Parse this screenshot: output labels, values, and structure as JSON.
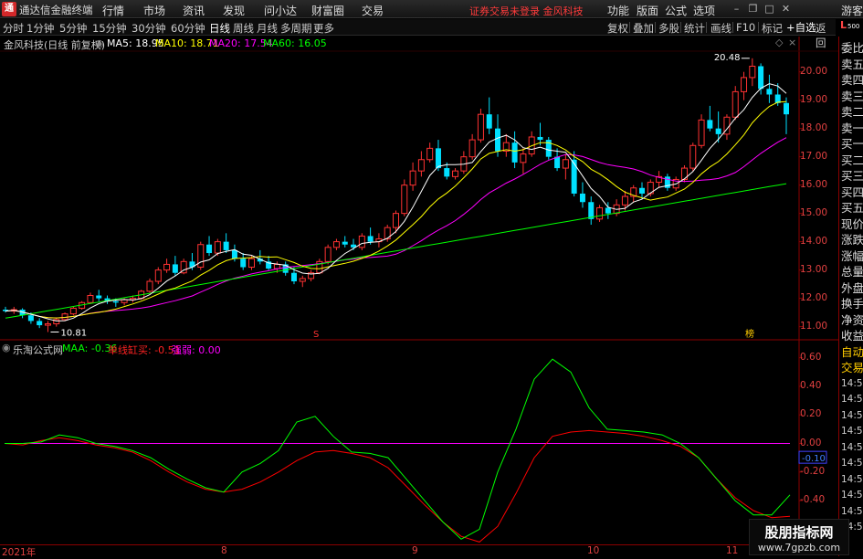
{
  "titlebar": {
    "logo": "通",
    "app_title": "通达信金融终端",
    "menu": [
      "行情",
      "市场",
      "资讯",
      "发现",
      "问小达",
      "财富圈",
      "交易"
    ],
    "warning": "证券交易未登录  金风科技",
    "right_menu": [
      "功能",
      "版面",
      "公式",
      "选项"
    ],
    "guest": "游客"
  },
  "periods": [
    "分时",
    "1分钟",
    "5分钟",
    "15分钟",
    "30分钟",
    "60分钟",
    "日线",
    "周线",
    "月线",
    "多周期",
    "更多"
  ],
  "active_period": "日线",
  "tools": [
    "复权",
    "叠加",
    "多股",
    "统计",
    "画线",
    "F10",
    "标记"
  ],
  "auto_select": "+自选",
  "back": "返回",
  "l_badge": "L",
  "l_sub": "500",
  "main_info": {
    "name": "金风科技(日线 前复权)",
    "ma5": "MA5: 18.95",
    "ma10": "MA10: 18.71",
    "ma20": "MA20: 17.54",
    "ma60": "MA60: 16.05"
  },
  "ind_info": {
    "name": "乐淘公式网",
    "maa": "MAA: -0.36",
    "bs": "单线缸买: -0.51",
    "qr": "强弱: 0.00"
  },
  "price_axis": [
    "20.00",
    "19.00",
    "18.00",
    "17.00",
    "16.00",
    "15.00",
    "14.00",
    "13.00",
    "12.00",
    "11.00"
  ],
  "ind_axis": [
    "0.60",
    "0.40",
    "0.20",
    "0.00",
    "-0.20",
    "-0.40"
  ],
  "ind_current": "-0.10",
  "right_panel": [
    "委比",
    "卖五",
    "卖四",
    "卖三",
    "卖二",
    "卖一",
    "买一",
    "买二",
    "买三",
    "买四",
    "买五",
    "现价",
    "涨跌",
    "涨幅",
    "总量",
    "外盘",
    "换手",
    "净资",
    "收益",
    "自动",
    "交易",
    "14:56",
    "14:56",
    "14:56",
    "14:56",
    "14:56",
    "14:56",
    "14:56",
    "14:56",
    "14:56",
    "14:56"
  ],
  "dates": [
    "2021年",
    "8",
    "9",
    "10",
    "11"
  ],
  "high_label": "20.48",
  "low_label": "10.81",
  "marker_s": "S",
  "marker_b": "榜",
  "watermark": {
    "line1": "股朋指标网",
    "line2": "www.7gpzb.com"
  },
  "colors": {
    "up": "#ff3232",
    "down": "#00e0ff",
    "ma5": "#ffffff",
    "ma10": "#ffff00",
    "ma20": "#ff00ff",
    "ma60": "#00ff00",
    "maa": "#00ff00",
    "bs": "#ff0000",
    "qr": "#ff00ff"
  },
  "chart_data": [
    {
      "type": "candlestick",
      "title": "金风科技(日线 前复权)",
      "ylim": [
        10.6,
        20.7
      ],
      "series_names": [
        "MA5",
        "MA10",
        "MA20",
        "MA60"
      ],
      "ohlc": [
        [
          11.6,
          11.7,
          11.5,
          11.55
        ],
        [
          11.55,
          11.7,
          11.45,
          11.6
        ],
        [
          11.6,
          11.65,
          11.3,
          11.4
        ],
        [
          11.4,
          11.5,
          11.1,
          11.2
        ],
        [
          11.2,
          11.3,
          10.95,
          11.05
        ],
        [
          11.05,
          11.2,
          10.81,
          11.1
        ],
        [
          11.1,
          11.3,
          11.0,
          11.25
        ],
        [
          11.25,
          11.5,
          11.2,
          11.45
        ],
        [
          11.45,
          11.7,
          11.4,
          11.65
        ],
        [
          11.65,
          11.9,
          11.6,
          11.85
        ],
        [
          11.85,
          12.2,
          11.8,
          12.1
        ],
        [
          12.1,
          12.3,
          11.9,
          12.0
        ],
        [
          12.0,
          12.1,
          11.8,
          11.9
        ],
        [
          11.9,
          12.0,
          11.7,
          11.85
        ],
        [
          11.85,
          12.0,
          11.75,
          11.95
        ],
        [
          11.95,
          12.1,
          11.85,
          12.0
        ],
        [
          12.0,
          12.3,
          11.95,
          12.25
        ],
        [
          12.25,
          12.7,
          12.2,
          12.6
        ],
        [
          12.6,
          13.1,
          12.5,
          13.0
        ],
        [
          13.0,
          13.4,
          12.9,
          13.2
        ],
        [
          13.2,
          13.5,
          12.8,
          12.9
        ],
        [
          12.9,
          13.4,
          12.85,
          13.3
        ],
        [
          13.3,
          13.6,
          13.0,
          13.1
        ],
        [
          13.1,
          14.0,
          13.0,
          13.9
        ],
        [
          13.9,
          14.2,
          13.5,
          13.6
        ],
        [
          13.6,
          14.1,
          13.5,
          14.0
        ],
        [
          14.0,
          14.3,
          13.6,
          13.7
        ],
        [
          13.7,
          13.9,
          13.3,
          13.4
        ],
        [
          13.4,
          13.6,
          13.0,
          13.1
        ],
        [
          13.1,
          13.5,
          13.0,
          13.4
        ],
        [
          13.4,
          13.7,
          13.2,
          13.3
        ],
        [
          13.3,
          13.5,
          13.0,
          13.05
        ],
        [
          13.05,
          13.3,
          12.9,
          13.2
        ],
        [
          13.2,
          13.3,
          12.8,
          12.9
        ],
        [
          12.9,
          13.1,
          12.5,
          12.6
        ],
        [
          12.6,
          12.8,
          12.4,
          12.7
        ],
        [
          12.7,
          13.0,
          12.6,
          12.9
        ],
        [
          12.9,
          13.4,
          12.85,
          13.3
        ],
        [
          13.3,
          13.9,
          13.2,
          13.8
        ],
        [
          13.8,
          14.1,
          13.7,
          14.0
        ],
        [
          14.0,
          14.2,
          13.8,
          13.9
        ],
        [
          13.9,
          14.1,
          13.7,
          13.8
        ],
        [
          13.8,
          14.3,
          13.7,
          14.2
        ],
        [
          14.2,
          14.5,
          13.9,
          14.0
        ],
        [
          14.0,
          14.3,
          13.8,
          14.1
        ],
        [
          14.1,
          14.6,
          14.0,
          14.5
        ],
        [
          14.5,
          15.1,
          14.3,
          15.0
        ],
        [
          15.0,
          16.2,
          14.9,
          16.0
        ],
        [
          16.0,
          16.8,
          15.8,
          16.5
        ],
        [
          16.5,
          17.2,
          16.3,
          16.9
        ],
        [
          16.9,
          17.5,
          16.8,
          17.3
        ],
        [
          17.3,
          17.6,
          16.5,
          16.6
        ],
        [
          16.6,
          16.8,
          16.2,
          16.3
        ],
        [
          16.3,
          16.6,
          16.2,
          16.5
        ],
        [
          16.5,
          17.2,
          16.4,
          17.0
        ],
        [
          17.0,
          17.8,
          16.9,
          17.6
        ],
        [
          17.6,
          18.7,
          17.5,
          18.5
        ],
        [
          18.5,
          19.1,
          17.8,
          18.0
        ],
        [
          18.0,
          18.5,
          17.0,
          17.2
        ],
        [
          17.2,
          17.8,
          17.0,
          17.5
        ],
        [
          17.5,
          17.9,
          16.6,
          16.8
        ],
        [
          16.8,
          17.3,
          16.4,
          17.1
        ],
        [
          17.1,
          17.9,
          17.0,
          17.7
        ],
        [
          17.7,
          18.2,
          17.4,
          17.6
        ],
        [
          17.6,
          17.7,
          16.9,
          17.0
        ],
        [
          17.0,
          17.3,
          16.5,
          16.6
        ],
        [
          16.6,
          17.1,
          16.2,
          16.9
        ],
        [
          16.9,
          17.2,
          15.6,
          15.7
        ],
        [
          15.7,
          16.1,
          15.2,
          15.4
        ],
        [
          15.4,
          15.6,
          14.6,
          14.8
        ],
        [
          14.8,
          15.3,
          14.7,
          15.2
        ],
        [
          15.2,
          15.4,
          14.8,
          15.0
        ],
        [
          15.0,
          15.5,
          14.9,
          15.3
        ],
        [
          15.3,
          15.8,
          15.1,
          15.6
        ],
        [
          15.6,
          16.0,
          15.4,
          15.9
        ],
        [
          15.9,
          16.1,
          15.5,
          15.7
        ],
        [
          15.7,
          16.2,
          15.6,
          16.1
        ],
        [
          16.1,
          16.5,
          15.9,
          16.3
        ],
        [
          16.3,
          16.4,
          15.8,
          15.9
        ],
        [
          15.9,
          16.3,
          15.8,
          16.2
        ],
        [
          16.2,
          16.7,
          16.1,
          16.6
        ],
        [
          16.6,
          17.5,
          16.5,
          17.4
        ],
        [
          17.4,
          18.5,
          17.3,
          18.3
        ],
        [
          18.3,
          18.8,
          17.9,
          18.0
        ],
        [
          18.0,
          18.6,
          17.5,
          17.8
        ],
        [
          17.8,
          18.5,
          17.6,
          18.4
        ],
        [
          18.4,
          19.5,
          18.3,
          19.3
        ],
        [
          19.3,
          20.0,
          19.0,
          19.8
        ],
        [
          19.8,
          20.48,
          19.5,
          20.2
        ],
        [
          20.2,
          20.3,
          19.2,
          19.4
        ],
        [
          19.4,
          19.9,
          18.9,
          19.2
        ],
        [
          19.2,
          19.6,
          18.8,
          18.9
        ],
        [
          18.9,
          19.1,
          17.8,
          18.5
        ]
      ]
    },
    {
      "type": "line",
      "title": "乐淘公式网",
      "ylim": [
        -0.7,
        0.7
      ],
      "series": [
        {
          "name": "MAA",
          "values": [
            0.0,
            0.0,
            0.01,
            0.06,
            0.04,
            0.0,
            -0.02,
            -0.05,
            -0.1,
            -0.18,
            -0.25,
            -0.31,
            -0.34,
            -0.2,
            -0.14,
            -0.05,
            0.15,
            0.19,
            0.05,
            -0.06,
            -0.07,
            -0.1,
            -0.25,
            -0.4,
            -0.55,
            -0.67,
            -0.6,
            -0.2,
            0.1,
            0.45,
            0.59,
            0.5,
            0.25,
            0.1,
            0.09,
            0.08,
            0.06,
            0.0,
            -0.1,
            -0.25,
            -0.4,
            -0.5,
            -0.5,
            -0.36
          ]
        },
        {
          "name": "单线缸买",
          "values": [
            0.0,
            -0.01,
            0.02,
            0.04,
            0.02,
            -0.01,
            -0.03,
            -0.06,
            -0.12,
            -0.2,
            -0.27,
            -0.32,
            -0.34,
            -0.32,
            -0.27,
            -0.2,
            -0.12,
            -0.06,
            -0.05,
            -0.07,
            -0.1,
            -0.17,
            -0.3,
            -0.43,
            -0.55,
            -0.65,
            -0.69,
            -0.58,
            -0.35,
            -0.1,
            0.05,
            0.08,
            0.09,
            0.08,
            0.07,
            0.05,
            0.02,
            -0.02,
            -0.1,
            -0.25,
            -0.38,
            -0.47,
            -0.52,
            -0.51
          ]
        },
        {
          "name": "强弱",
          "values": [
            0.0,
            0.0,
            0.0,
            0.0,
            0.0,
            0.0,
            0.0,
            0.0,
            0.0,
            0.0,
            0.0,
            0.0,
            0.0,
            0.0,
            0.0,
            0.0,
            0.0,
            0.0,
            0.0,
            0.0,
            0.0,
            0.0,
            0.0,
            0.0,
            0.0,
            0.0,
            0.0,
            0.0,
            0.0,
            0.0,
            0.0,
            0.0,
            0.0,
            0.0,
            0.0,
            0.0,
            0.0,
            0.0,
            0.0,
            0.0,
            0.0,
            0.0,
            0.0,
            0.0
          ]
        }
      ]
    }
  ]
}
